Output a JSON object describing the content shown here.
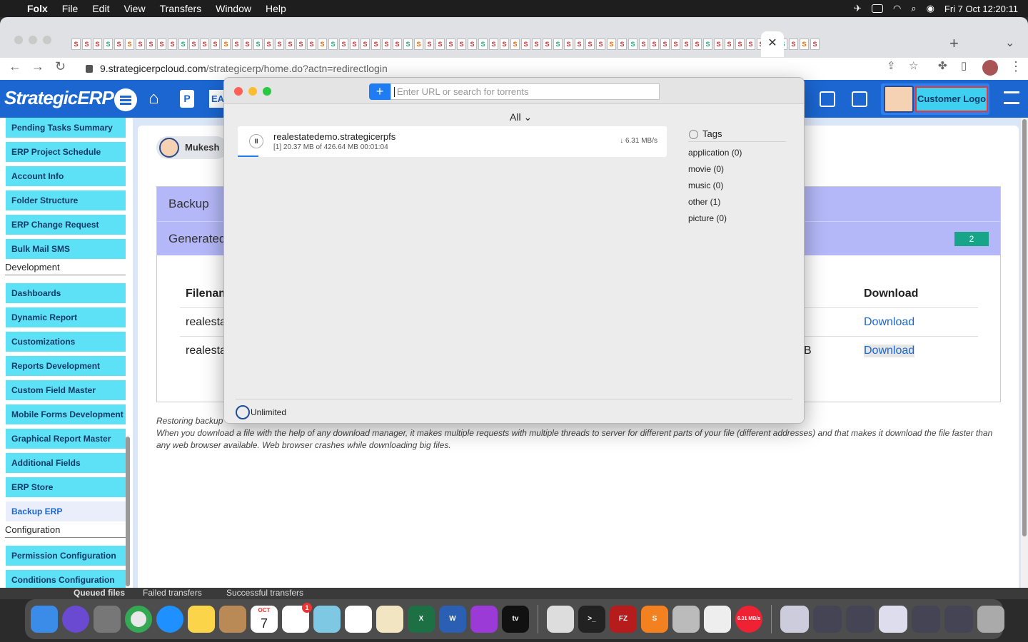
{
  "menubar": {
    "app": "Folx",
    "items": [
      "File",
      "Edit",
      "View",
      "Transfers",
      "Window",
      "Help"
    ],
    "clock": "Fri 7 Oct  12:20:11"
  },
  "browser": {
    "url_host": "9.strategicerpcloud.com",
    "url_path": "/strategicerp/home.do?actn=redirectlogin",
    "tab_favicons": [
      "S",
      "S",
      "S",
      "S",
      "S",
      "S",
      "S",
      "S",
      "S",
      "S",
      "S",
      "S",
      "S",
      "S",
      "S",
      "S",
      "S",
      "S",
      "S",
      "S",
      "S",
      "S",
      "S",
      "S",
      "S",
      "S",
      "S",
      "S",
      "S",
      "S",
      "S",
      "S",
      "S",
      "S",
      "S",
      "S",
      "S",
      "S",
      "S",
      "S",
      "S",
      "S",
      "S",
      "S",
      "S",
      "S",
      "S",
      "S",
      "S",
      "S",
      "S",
      "S",
      "S",
      "S",
      "S",
      "S",
      "S",
      "S",
      "S",
      "S",
      "S",
      "S",
      "S",
      "S",
      "S",
      "S",
      "S",
      "S",
      "S",
      "S"
    ]
  },
  "erp": {
    "logo": "StrategicERP",
    "header_p": "P",
    "header_ea": "EA",
    "customer_logo": "Customer Logo",
    "user": "Mukesh",
    "sidebar": {
      "items_a": [
        "Pending Tasks Summary",
        "ERP Project Schedule",
        "Account Info",
        "Folder Structure",
        "ERP Change Request",
        "Bulk Mail SMS"
      ],
      "head_dev": "Development",
      "items_b": [
        "Dashboards",
        "Dynamic Report",
        "Customizations",
        "Reports Development",
        "Custom Field Master",
        "Mobile Forms Development",
        "Graphical Report Master",
        "Additional Fields",
        "ERP Store",
        "Backup ERP"
      ],
      "head_config": "Configuration",
      "items_c": [
        "Permission Configuration",
        "Conditions Configuration"
      ]
    },
    "backup": {
      "title": "Backup",
      "generated": "Generated",
      "count": "2",
      "col_filename": "Filenam",
      "col_download": "Download",
      "rows": [
        {
          "file": "realesta",
          "size": "",
          "download": "Download"
        },
        {
          "file": "realesta",
          "size": "B",
          "download": "Download"
        }
      ]
    },
    "note_line1": "Restoring backup",
    "note_line2": "When you download a file with the help of any download manager, it makes multiple requests with multiple threads to server for different parts of your file (different addresses) and that makes it download the file faster than any web browser available. Web browser crashes while downloading big files."
  },
  "folx": {
    "search_placeholder": "Enter URL or search for torrents",
    "filter": "All",
    "download": {
      "name": "realestatedemo.strategicerpfs",
      "index": "[1]",
      "progress_text": "20.37 MB of 426.64 MB  00:01:04",
      "speed": "6.31 MB/s",
      "progress_fraction": 0.048
    },
    "tags_title": "Tags",
    "tags": [
      "application (0)",
      "movie (0)",
      "music (0)",
      "other (1)",
      "picture (0)"
    ],
    "speed_limit": "Unlimited"
  },
  "transfers_strip": [
    "Queued files",
    "Failed transfers",
    "Successful transfers"
  ],
  "dock": {
    "calendar_month": "OCT",
    "calendar_day": "7",
    "reminders_badge": "1",
    "folx_speed": "6.31 MB/s"
  }
}
